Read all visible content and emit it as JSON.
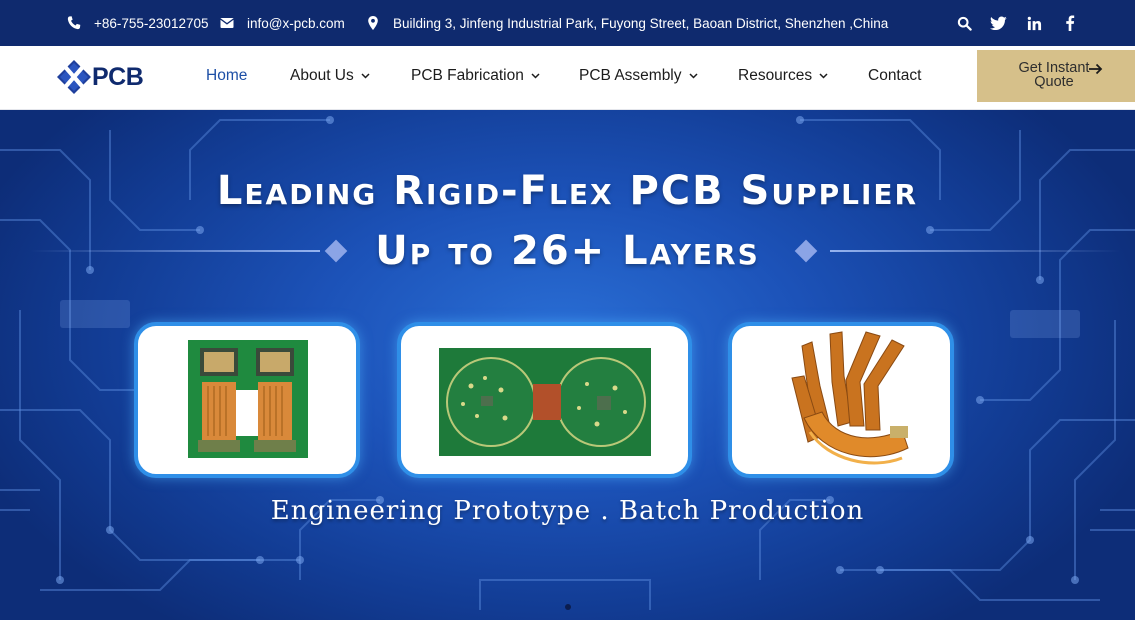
{
  "topbar": {
    "phone": "+86-755-23012705",
    "email": "info@x-pcb.com",
    "address": "Building 3, Jinfeng Industrial Park, Fuyong Street, Baoan District, Shenzhen ,China",
    "icons": [
      "phone-icon",
      "envelope-icon",
      "map-marker-icon",
      "search-icon",
      "twitter-icon",
      "linkedin-icon",
      "facebook-icon"
    ]
  },
  "header": {
    "logo_text": "PCB",
    "logo_mark": "X",
    "nav": [
      {
        "label": "Home",
        "active": true,
        "has_dropdown": false
      },
      {
        "label": "About Us",
        "active": false,
        "has_dropdown": true
      },
      {
        "label": "PCB Fabrication",
        "active": false,
        "has_dropdown": true
      },
      {
        "label": "PCB Assembly",
        "active": false,
        "has_dropdown": true
      },
      {
        "label": "Resources",
        "active": false,
        "has_dropdown": true
      },
      {
        "label": "Contact",
        "active": false,
        "has_dropdown": false
      }
    ],
    "quote_button": "Get Instant Quote"
  },
  "hero": {
    "headline_line1": "Leading Rigid-Flex PCB Supplier",
    "headline_line2": "Up to 26+ Layers",
    "tagline": "Engineering Prototype . Batch Production",
    "slides_total": 1,
    "active_slide": 1
  },
  "colors": {
    "topbar_bg": "#0f2a6e",
    "nav_active": "#1d4fa6",
    "quote_button_bg": "#d6c08a",
    "hero_blue": "#1c52b8",
    "card_border": "#2f8fe8",
    "pcb_green": "#1e7a3a",
    "flex_copper": "#c9731f"
  }
}
